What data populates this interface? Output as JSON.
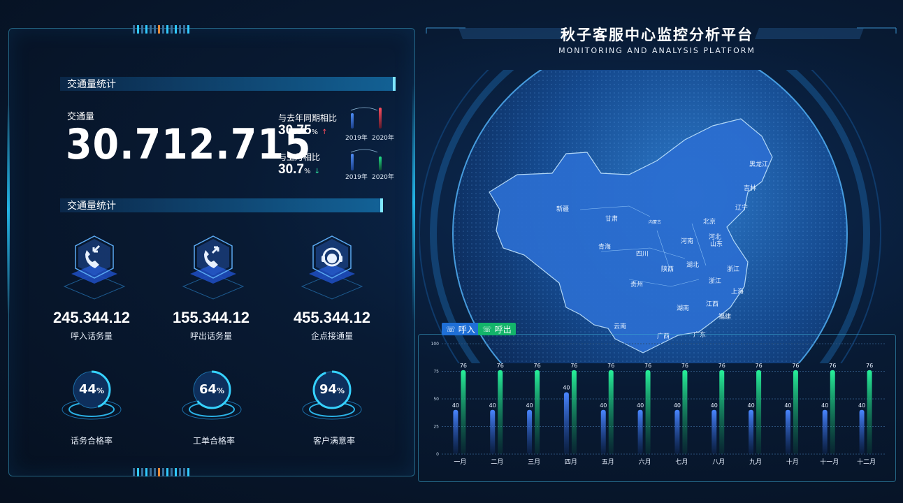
{
  "header": {
    "title": "秋子客服中心监控分析平台",
    "subtitle": "MONITORING AND ANALYSIS PLATFORM"
  },
  "traffic": {
    "section_title": "交通量统计",
    "label": "交通量",
    "value": "30.712.715",
    "yoy_label": "与去年同期相比",
    "yoy_value": "30.75",
    "yoy_unit": "%",
    "yoy_arrow": "↑",
    "mom_label": "与上月相比",
    "mom_value": "30.7",
    "mom_unit": "%",
    "mom_arrow": "↓",
    "year_a": "2019年",
    "year_b": "2020年"
  },
  "stats": {
    "section_title": "交通量统计",
    "tiles": [
      {
        "value": "245.344.12",
        "label": "呼入话务量",
        "icon": "phone-incoming-icon"
      },
      {
        "value": "155.344.12",
        "label": "呼出话务量",
        "icon": "phone-outgoing-icon"
      },
      {
        "value": "455.344.12",
        "label": "企点接通量",
        "icon": "headset-icon"
      }
    ],
    "rates": [
      {
        "value": "44",
        "unit": "%",
        "label": "话务合格率"
      },
      {
        "value": "64",
        "unit": "%",
        "label": "工单合格率"
      },
      {
        "value": "94",
        "unit": "%",
        "label": "客户满意率"
      }
    ]
  },
  "map": {
    "labels": [
      "新疆",
      "甘肃",
      "内蒙古",
      "黑龙江",
      "吉林",
      "辽宁",
      "北京",
      "河北",
      "青海",
      "河南",
      "山东",
      "四川",
      "陕西",
      "湖北",
      "浙江",
      "贵州",
      "浙江",
      "湖南",
      "江西",
      "上海",
      "云南",
      "广西",
      "广东",
      "福建"
    ]
  },
  "chart_data": {
    "type": "bar",
    "legend": [
      "呼入",
      "呼出"
    ],
    "categories": [
      "一月",
      "二月",
      "三月",
      "四月",
      "五月",
      "六月",
      "七月",
      "八月",
      "九月",
      "十月",
      "十一月",
      "十二月"
    ],
    "series": [
      {
        "name": "呼入",
        "values": [
          40,
          40,
          40,
          56,
          40,
          40,
          40,
          40,
          40,
          40,
          40,
          40
        ],
        "labels": [
          40,
          40,
          40,
          40,
          40,
          40,
          40,
          40,
          40,
          40,
          40,
          40
        ],
        "color": "#3a7be8"
      },
      {
        "name": "呼出",
        "values": [
          76,
          76,
          76,
          76,
          76,
          76,
          76,
          76,
          76,
          76,
          76,
          76
        ],
        "color": "#22e08a"
      }
    ],
    "ylim": [
      0,
      100
    ],
    "yticks": [
      0,
      25,
      50,
      75,
      100
    ],
    "grid": true,
    "legend_position": "top-left"
  },
  "colors": {
    "accent": "#23b4e6",
    "incoming": "#3a7be8",
    "outgoing": "#22e08a",
    "up": "#ff4d5e",
    "down": "#2ee3a0"
  }
}
